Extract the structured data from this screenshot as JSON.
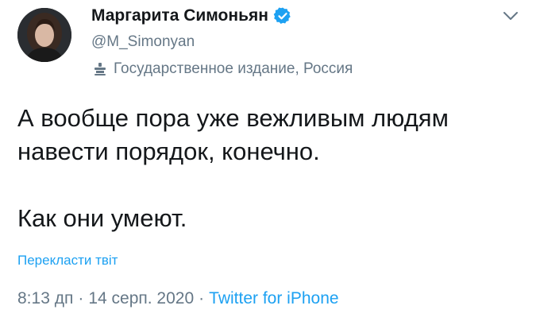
{
  "author": {
    "display_name": "Маргарита Симоньян",
    "handle": "@M_Simonyan",
    "verified_icon": "verified-badge-icon",
    "avatar_icon": "profile-photo"
  },
  "account_label": {
    "icon": "podium-icon",
    "text": "Государственное издание, Россия"
  },
  "more_menu_icon": "chevron-down-icon",
  "tweet": {
    "line1": "А вообще пора уже вежливым людям",
    "line2": "навести порядок, конечно.",
    "line3": "Как они умеют."
  },
  "translate_label": "Перекласти твіт",
  "meta": {
    "time": "8:13 дп",
    "separator": "·",
    "date": "14 серп. 2020",
    "source": "Twitter for iPhone"
  },
  "colors": {
    "accent": "#1da1f2",
    "secondary_text": "#657786",
    "primary_text": "#14171a"
  }
}
